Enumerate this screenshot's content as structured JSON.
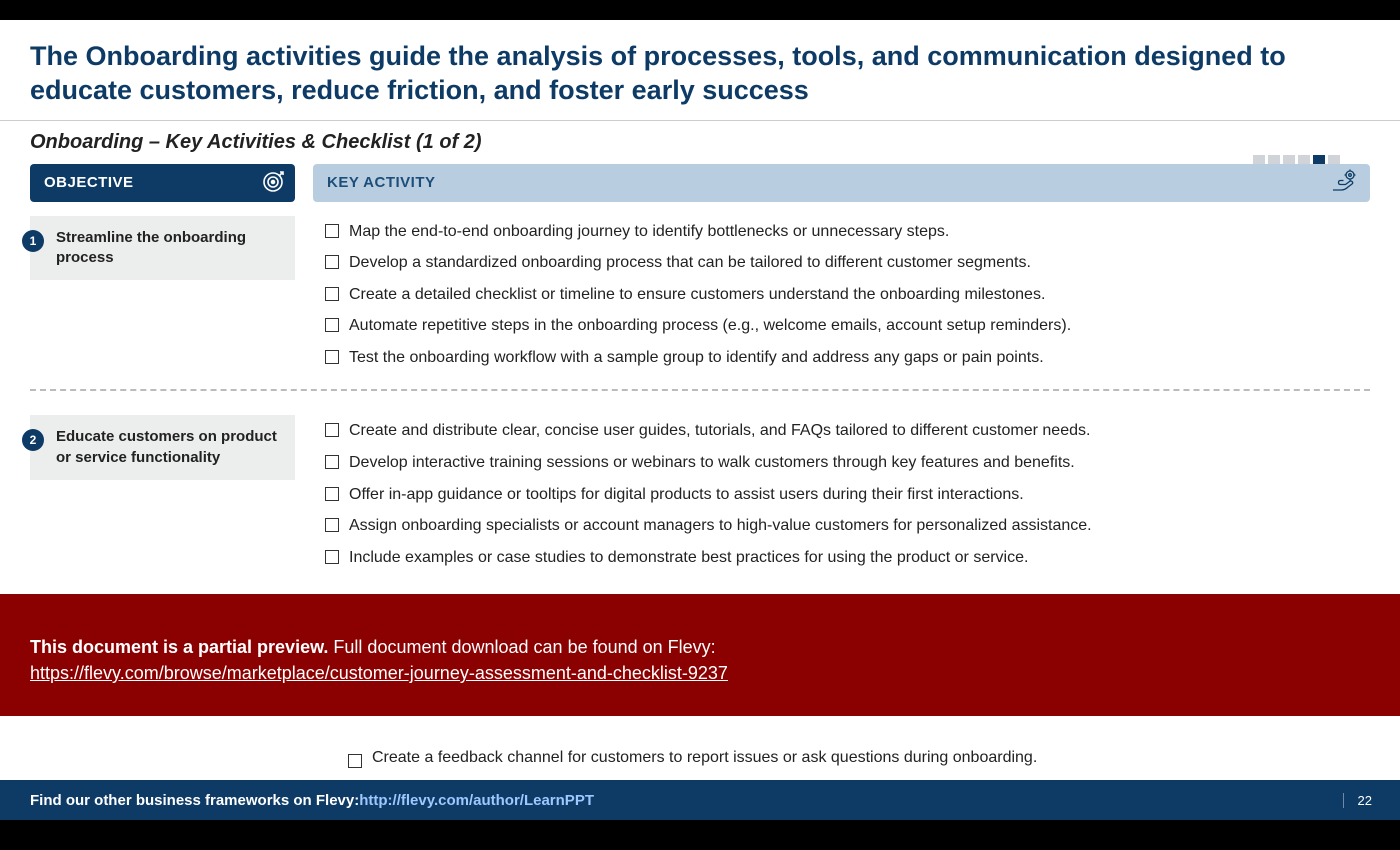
{
  "title": "The Onboarding activities guide the analysis of processes, tools, and communication designed to educate customers, reduce friction, and foster early success",
  "subtitle": "Onboarding – Key Activities & Checklist (1 of 2)",
  "headers": {
    "objective": "OBJECTIVE",
    "key_activity": "KEY ACTIVITY"
  },
  "sections": [
    {
      "num": "1",
      "objective": "Streamline the onboarding process",
      "activities": [
        "Map the end-to-end onboarding journey to identify bottlenecks or unnecessary steps.",
        "Develop a standardized onboarding process that can be tailored to different customer segments.",
        "Create a detailed checklist or timeline to ensure customers understand the onboarding milestones.",
        "Automate repetitive steps in the onboarding process (e.g., welcome emails, account setup reminders).",
        "Test the onboarding workflow with a sample group to identify and address any gaps or pain points."
      ]
    },
    {
      "num": "2",
      "objective": "Educate customers on product or service functionality",
      "activities": [
        "Create and distribute clear, concise user guides, tutorials, and FAQs tailored to different customer needs.",
        "Develop interactive training sessions or webinars to walk customers through key features and benefits.",
        "Offer in-app guidance or tooltips for digital products to assist users during their first interactions.",
        "Assign onboarding specialists or account managers to high-value customers for personalized assistance.",
        "Include examples or case studies to demonstrate best practices for using the product or service."
      ]
    }
  ],
  "partial_visible_line": "Create a feedback channel for customers to report issues or ask questions during onboarding.",
  "preview": {
    "bold": "This document is a partial preview.",
    "rest": "  Full document download can be found on Flevy:",
    "url": "https://flevy.com/browse/marketplace/customer-journey-assessment-and-checklist-9237"
  },
  "footer": {
    "lead": "Find our other business frameworks on Flevy: ",
    "link": "http://flevy.com/author/LearnPPT",
    "page": "22"
  }
}
